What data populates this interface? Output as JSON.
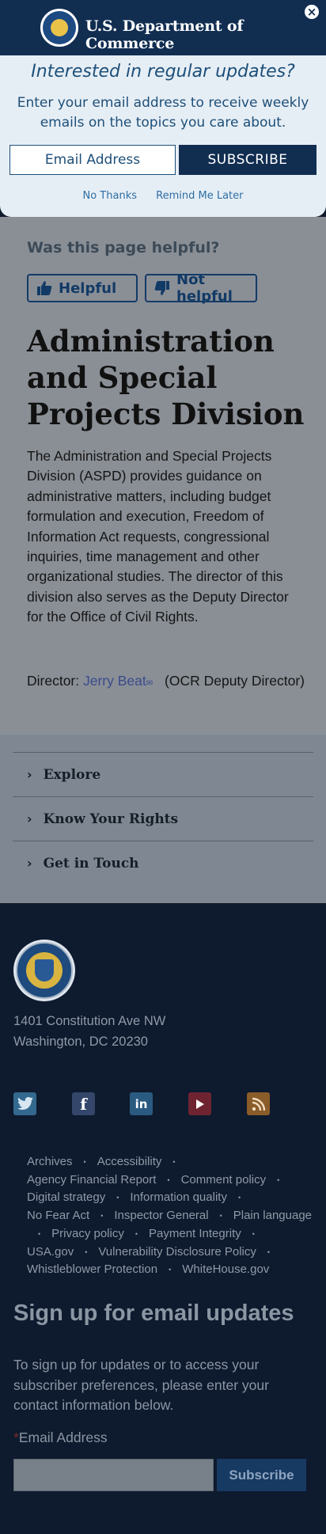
{
  "header": {
    "title": "U.S. Department of Commerce",
    "close_glyph": "×"
  },
  "popup": {
    "title": "Interested in regular updates?",
    "description": "Enter your email address to receive weekly emails on the topics you care about.",
    "email_placeholder": "Email Address",
    "subscribe_label": "SUBSCRIBE",
    "no_thanks": "No Thanks",
    "remind_later": "Remind Me Later"
  },
  "feedback": {
    "question": "Was this page helpful?",
    "helpful": "Helpful",
    "not_helpful": "Not helpful"
  },
  "main": {
    "title": "Administration and Special Projects Division",
    "body": "The Administration and Special Projects Division (ASPD) provides guidance on administrative matters, including budget formulation and execution, Freedom of Information Act requests, congressional inquiries, time management and other organizational studies.  The director of this division also serves as the Deputy Director for the Office of Civil Rights.",
    "director_label": "Director:",
    "director_name": "Jerry Beat",
    "director_role": "(OCR Deputy Director)"
  },
  "accordion": {
    "items": [
      "Explore",
      "Know Your Rights",
      "Get in Touch"
    ]
  },
  "footer": {
    "address_line1": "1401 Constitution Ave NW",
    "address_line2": "Washington, DC 20230",
    "social": [
      "twitter-icon",
      "facebook-icon",
      "linkedin-icon",
      "youtube-icon",
      "rss-icon"
    ],
    "links": [
      "Archives",
      "Accessibility",
      "Agency Financial Report",
      "Comment policy",
      "Digital strategy",
      "Information quality",
      "No Fear Act",
      "Inspector General",
      "Plain language",
      "Privacy policy",
      "Payment Integrity",
      "USA.gov",
      "Vulnerability Disclosure Policy",
      "Whistleblower Protection",
      "WhiteHouse.gov"
    ],
    "signup_title": "Sign up for email updates",
    "signup_desc": "To sign up for updates or to access your subscriber preferences, please enter your contact information below.",
    "signup_required": "*",
    "signup_label": "Email Address",
    "signup_button": "Subscribe"
  },
  "colors": {
    "header": "#112e51",
    "popup_bg": "#e6eef5",
    "footer_bg": "#0e1a2e"
  }
}
